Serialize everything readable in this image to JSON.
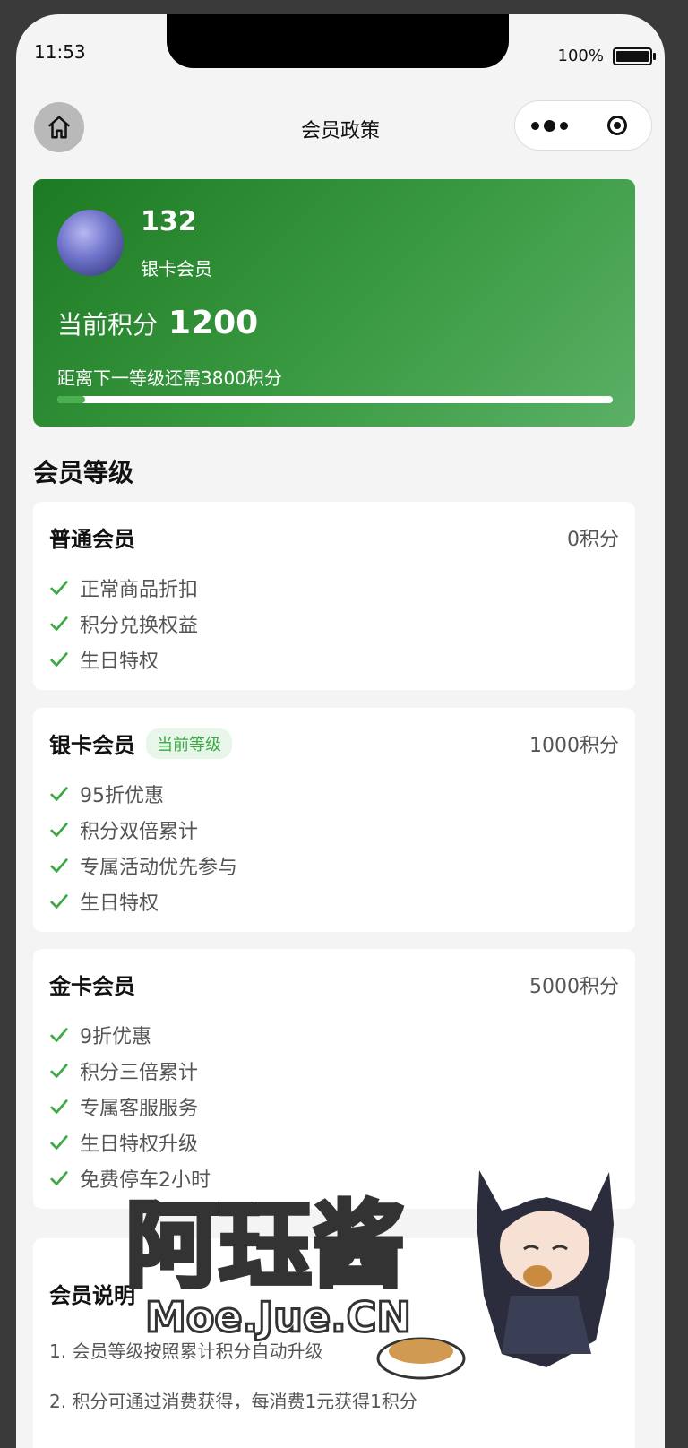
{
  "status_bar": {
    "time": "11:53",
    "battery": "100%"
  },
  "nav": {
    "title": "会员政策"
  },
  "user": {
    "name": "132",
    "level": "银卡会员",
    "points_label": "当前积分",
    "points": "1200",
    "next_level_text": "距离下一等级还需3800积分",
    "progress": 0.05
  },
  "levels_section_title": "会员等级",
  "levels": [
    {
      "name": "普通会员",
      "points": "0积分",
      "badge": "",
      "benefits": [
        "正常商品折扣",
        "积分兑换权益",
        "生日特权"
      ]
    },
    {
      "name": "银卡会员",
      "points": "1000积分",
      "badge": "当前等级",
      "benefits": [
        "95折优惠",
        "积分双倍累计",
        "专属活动优先参与",
        "生日特权"
      ]
    },
    {
      "name": "金卡会员",
      "points": "5000积分",
      "badge": "",
      "benefits": [
        "9折优惠",
        "积分三倍累计",
        "专属客服服务",
        "生日特权升级",
        "免费停车2小时"
      ]
    }
  ],
  "notes": {
    "title": "会员说明",
    "items": [
      "1. 会员等级按照累计积分自动升级",
      "2. 积分可通过消费获得，每消费1元获得1积分"
    ]
  },
  "watermark": {
    "text": "阿珏酱",
    "site": "Moe.Jue.CN"
  },
  "colors": {
    "accent": "#3da944",
    "hero_start": "#1c7a22",
    "hero_end": "#5bb066"
  },
  "icons": {
    "home": "home-icon",
    "more": "more-dots-icon",
    "close": "target-icon",
    "check": "check-icon"
  }
}
